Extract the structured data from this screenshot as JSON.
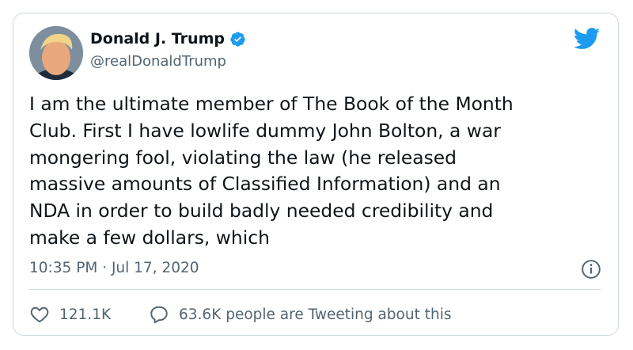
{
  "tweet": {
    "author": {
      "display_name": "Donald J. Trump",
      "handle": "@realDonaldTrump",
      "verified": true,
      "avatar_icon": "profile-photo"
    },
    "text_lines": [
      "I am the ultimate member of The Book of the Month",
      "Club. First I have lowlife dummy John Bolton, a war",
      "mongering fool, violating the law (he released",
      "massive amounts of Classified Information) and an",
      "NDA in order to build badly needed credibility and",
      "make a few dollars, which"
    ],
    "timestamp": "10:35 PM · Jul 17, 2020",
    "stats": {
      "likes": "121.1K",
      "tweeting": "63.6K people are Tweeting about this"
    }
  },
  "colors": {
    "brand_blue": "#1d9bf0",
    "text_primary": "#0f1419",
    "text_secondary": "#536471",
    "border": "#cfd9de"
  },
  "icons": {
    "brand": "twitter-bird-icon",
    "verified": "verified-badge-icon",
    "info": "info-icon",
    "like": "heart-icon",
    "reply": "speech-bubble-icon"
  }
}
